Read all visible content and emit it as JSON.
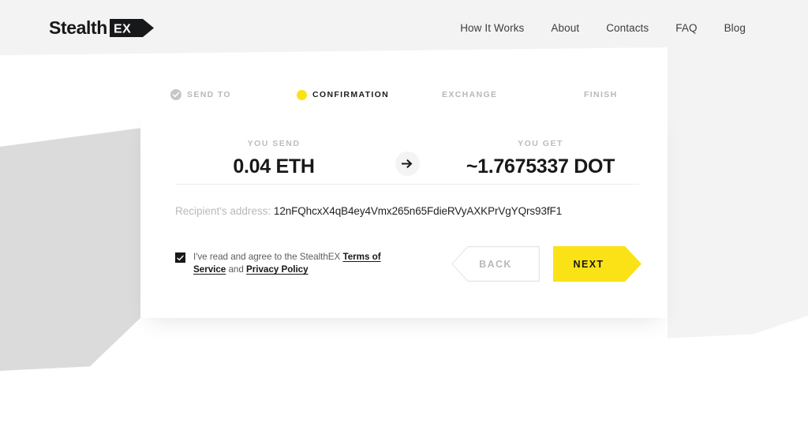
{
  "brand": {
    "logo_word": "Stealth",
    "logo_badge": "EX",
    "accent_color": "#fbe216",
    "text_color": "#17181a"
  },
  "nav": {
    "items": [
      {
        "label": "How It Works"
      },
      {
        "label": "About"
      },
      {
        "label": "Contacts"
      },
      {
        "label": "FAQ"
      },
      {
        "label": "Blog"
      }
    ]
  },
  "steps": [
    {
      "label": "SEND TO",
      "state": "completed",
      "icon": "check-circle-icon"
    },
    {
      "label": "CONFIRMATION",
      "state": "active",
      "icon": "dot-icon"
    },
    {
      "label": "EXCHANGE",
      "state": "upcoming",
      "icon": "none"
    },
    {
      "label": "FINISH",
      "state": "upcoming",
      "icon": "none"
    }
  ],
  "exchange": {
    "send_label": "YOU SEND",
    "send_value": "0.04 ETH",
    "swap_icon": "arrow-right-icon",
    "get_label": "YOU GET",
    "get_value": "~1.7675337 DOT"
  },
  "recipient": {
    "label": "Recipient's address:",
    "address": "12nFQhcxX4qB4ey4Vmx265n65FdieRVyAXKPrVgYQrs93fF1"
  },
  "agreement": {
    "checked": true,
    "text_before": "I've read and agree to the StealthEX ",
    "terms_link": "Terms of Service",
    "text_between": " and",
    "privacy_link": "Privacy Policy"
  },
  "actions": {
    "back_label": "BACK",
    "next_label": "NEXT"
  }
}
